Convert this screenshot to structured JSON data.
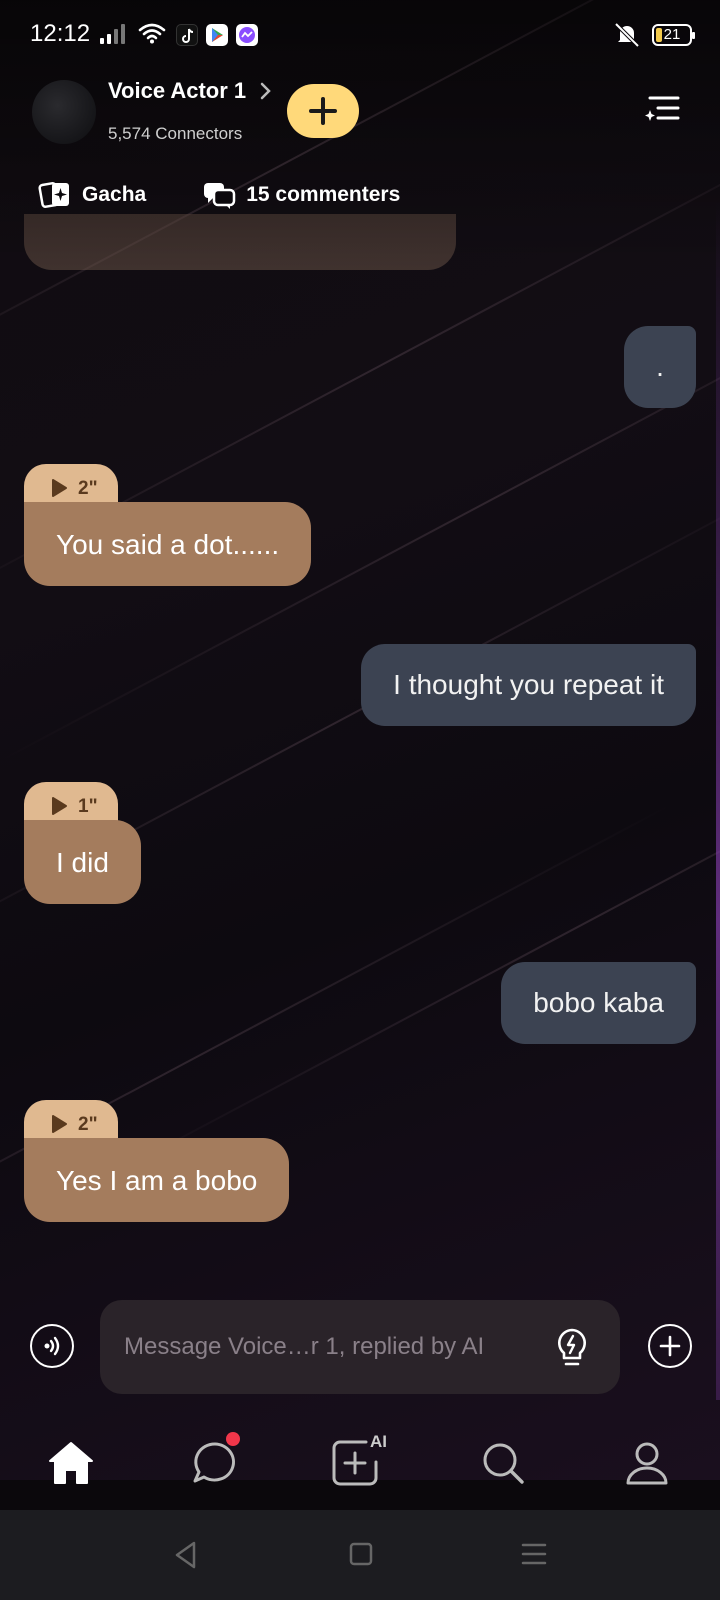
{
  "status_bar": {
    "time": "12:12",
    "battery": "21"
  },
  "header": {
    "title": "Voice Actor 1",
    "connectors": "5,574 Connectors"
  },
  "chips": {
    "gacha": "Gacha",
    "commenters": "15 commenters"
  },
  "messages": [
    {
      "from": "user",
      "text": "."
    },
    {
      "from": "bot",
      "duration": "2\"",
      "text": "You said a dot......"
    },
    {
      "from": "user",
      "text": "I thought you repeat it"
    },
    {
      "from": "bot",
      "duration": "1\"",
      "text": "I did"
    },
    {
      "from": "user",
      "text": "bobo kaba"
    },
    {
      "from": "bot",
      "duration": "2\"",
      "text": "Yes I am a bobo"
    }
  ],
  "composer": {
    "placeholder": "Message Voice…r 1, replied by AI"
  },
  "tab_bar": {
    "create_badge": "AI"
  },
  "colors": {
    "accent_yellow": "#ffd97a",
    "bot_bubble": "#a47c5d",
    "bot_voice_tag": "#e0b990",
    "user_bubble": "#3c4352",
    "notification_dot": "#f0364a"
  },
  "icons": [
    "signal-icon",
    "wifi-icon",
    "tiktok-icon",
    "play-store-icon",
    "messenger-icon",
    "mute-icon",
    "battery-icon",
    "chevron-right-icon",
    "plus-icon",
    "sparkle-menu-icon",
    "gacha-icon",
    "comments-icon",
    "play-icon",
    "voice-mode-icon",
    "lightbulb-icon",
    "plus-circle-icon",
    "home-icon",
    "chat-icon",
    "ai-create-icon",
    "search-icon",
    "profile-icon",
    "back-icon",
    "home-square-icon",
    "recents-icon"
  ]
}
